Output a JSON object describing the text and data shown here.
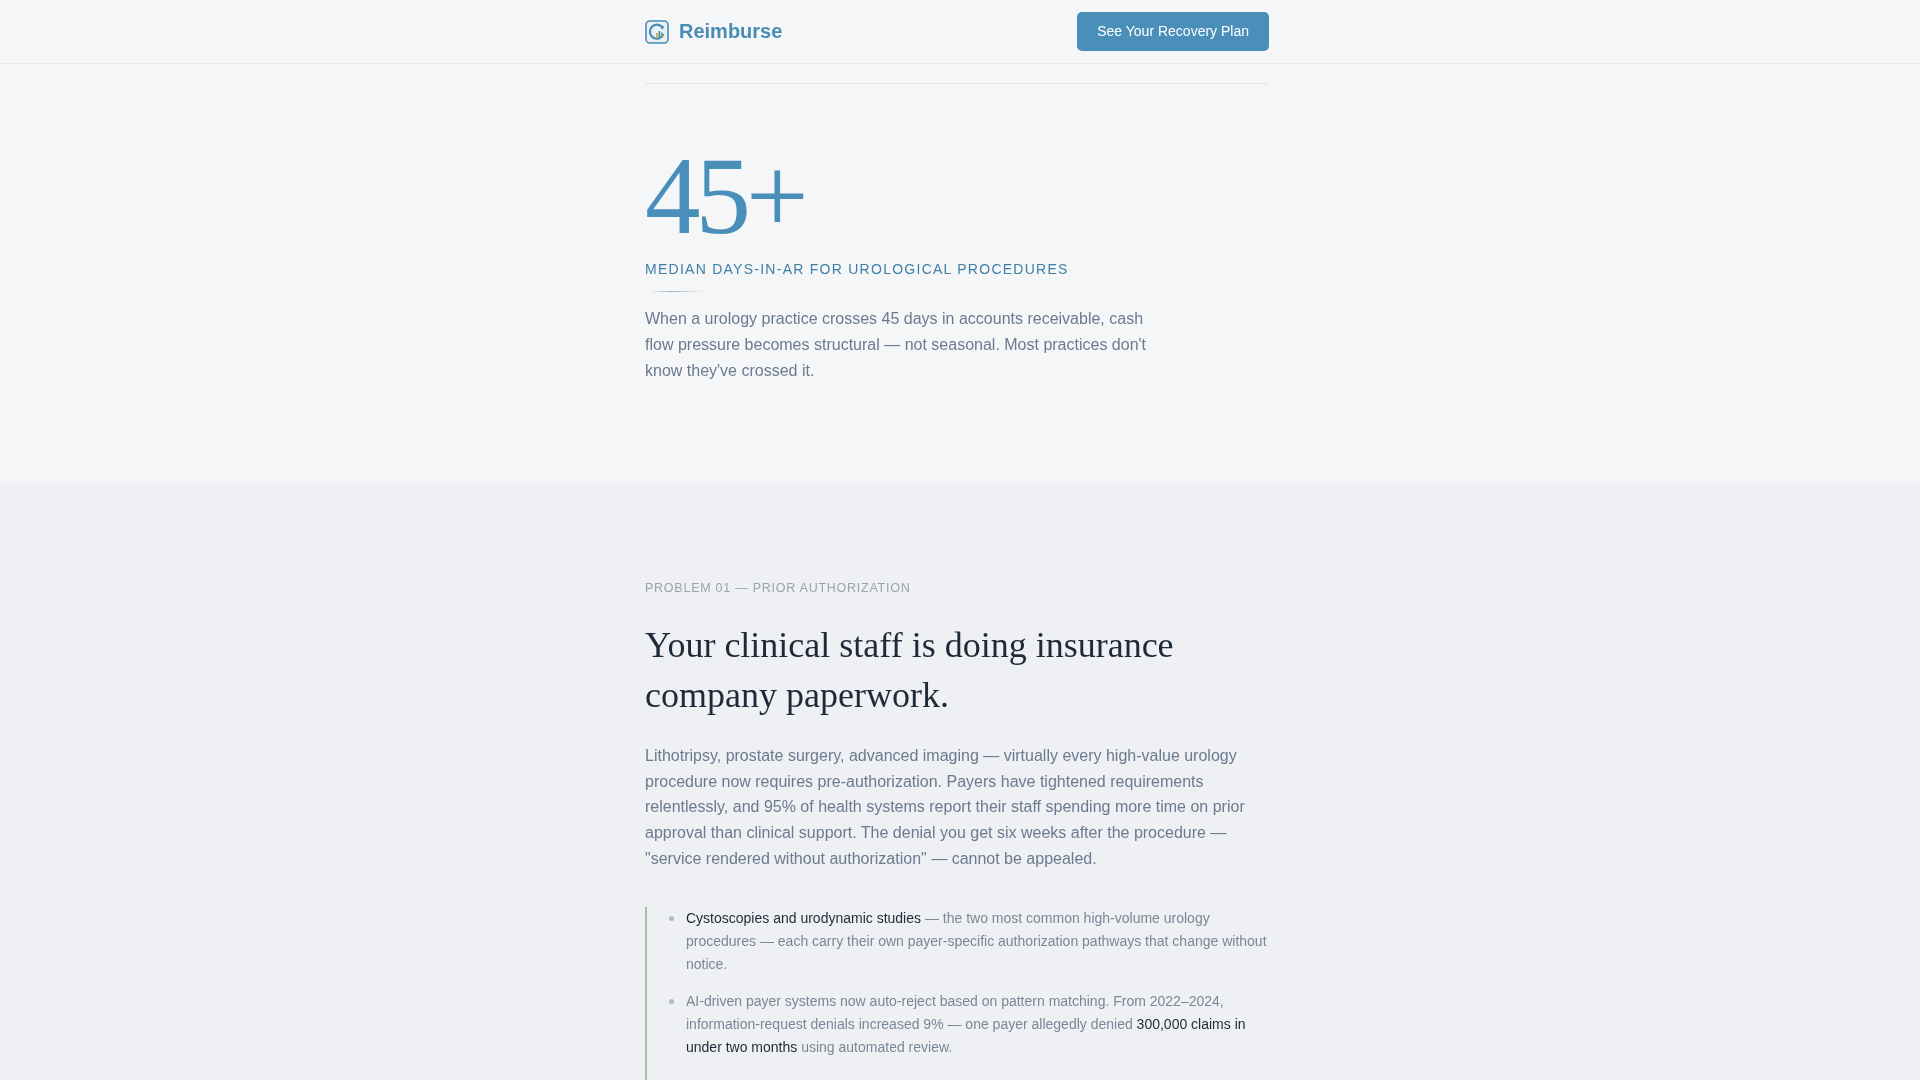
{
  "header": {
    "brand": "Reimburse",
    "cta": "See Your Recovery Plan"
  },
  "hero": {
    "stat": "45+",
    "stat_label": "MEDIAN DAYS-IN-AR FOR UROLOGICAL PROCEDURES",
    "description": "When a urology practice crosses 45 days in accounts receivable, cash flow pressure becomes structural — not seasonal. Most practices don't know they've crossed it."
  },
  "problem": {
    "eyebrow": "PROBLEM 01 — PRIOR AUTHORIZATION",
    "heading": "Your clinical staff is doing insurance company paperwork.",
    "body": "Lithotripsy, prostate surgery, advanced imaging — virtually every high-value urology procedure now requires pre-authorization. Payers have tightened requirements relentlessly, and 95% of health systems report their staff spending more time on prior approval than clinical support. The denial you get six weeks after the procedure — \"service rendered without authorization\" — cannot be appealed.",
    "points": [
      "**Cystoscopies and urodynamic studies** — the two most common high-volume urology procedures — each carry their own payer-specific authorization pathways that change without notice.",
      "AI-driven payer systems now auto-reject based on pattern matching. From 2022–2024, information-request denials increased 9% — one payer allegedly denied **300,000 claims in under two months** using automated review."
    ]
  }
}
